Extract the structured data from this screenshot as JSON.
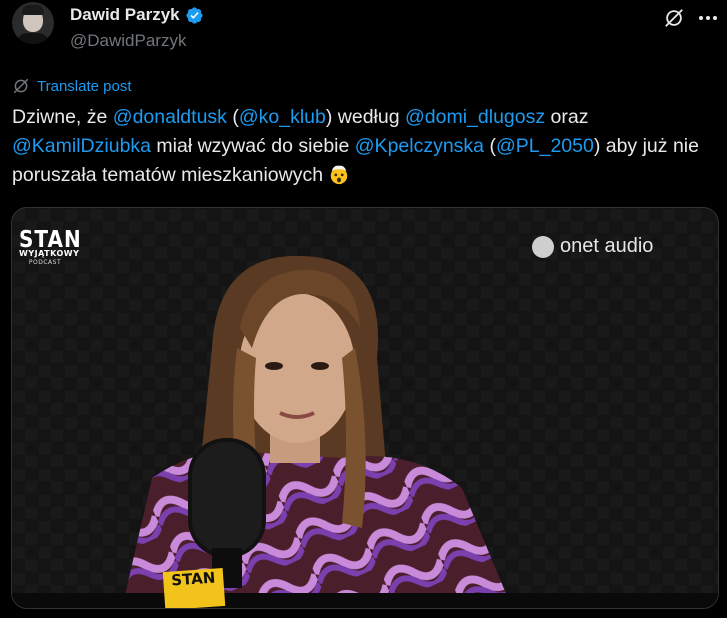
{
  "author": {
    "display_name": "Dawid Parzyk",
    "handle": "@DawidParzyk",
    "avatar_icon": "person-avatar",
    "verified_icon": "verified-badge-icon",
    "verified_color": "#1d9bf0"
  },
  "header_actions": {
    "grok_icon": "grok-icon",
    "more_icon": "more-options-icon"
  },
  "translate": {
    "label": "Translate post",
    "icon": "translate-icon"
  },
  "tweet": {
    "parts": [
      "Dziwne, że ",
      "@donaldtusk",
      " (",
      "@ko_klub",
      ") według ",
      "@domi_dlugosz",
      " oraz ",
      "@KamilDziubka",
      " miał wzywać do siebie ",
      "@Kpelczynska",
      " (",
      "@PL_2050",
      ") aby już nie poruszała tematów mieszkaniowych"
    ],
    "emoji": "exploding-head-emoji"
  },
  "media": {
    "logo_line1": "STAN",
    "logo_line2": "WYJĄTKOWY",
    "logo_line3": "PODCAST",
    "brand": "onet audio",
    "mic_label": "STAN"
  },
  "colors": {
    "background": "#000000",
    "text": "#e7e9ea",
    "secondary": "#71767b",
    "link": "#1d9bf0"
  }
}
